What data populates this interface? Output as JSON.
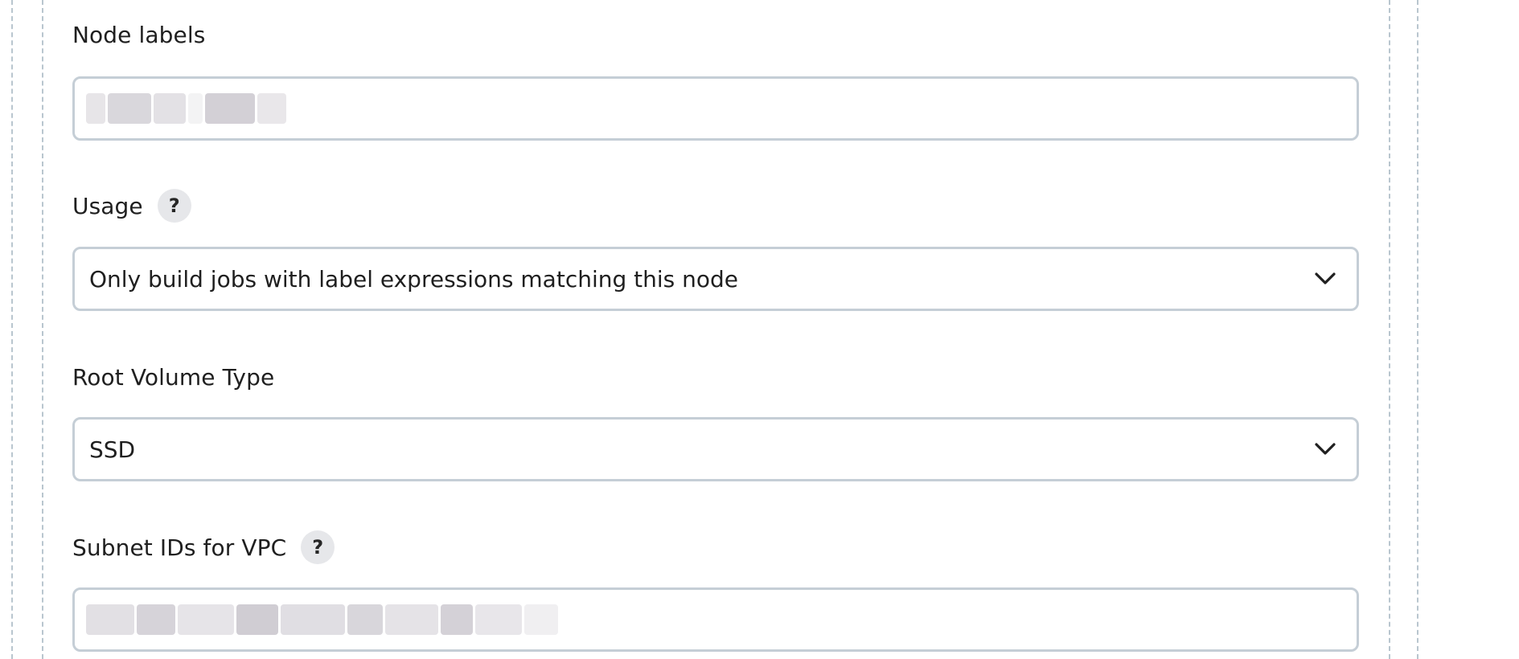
{
  "form": {
    "node_labels": {
      "label": "Node labels",
      "value": ""
    },
    "usage": {
      "label": "Usage",
      "help": "?",
      "selected": "Only build jobs with label expressions matching this node"
    },
    "root_volume_type": {
      "label": "Root Volume Type",
      "selected": "SSD"
    },
    "subnet_ids": {
      "label": "Subnet IDs for VPC",
      "help": "?",
      "value": ""
    }
  },
  "icons": {
    "help": "help-circle-icon",
    "dropdown": "chevron-down-icon"
  },
  "colors": {
    "border": "#c5ced6",
    "dashed_border": "#b9c6cf",
    "help_bg": "#e6e7ea",
    "text": "#1f1f1f"
  }
}
